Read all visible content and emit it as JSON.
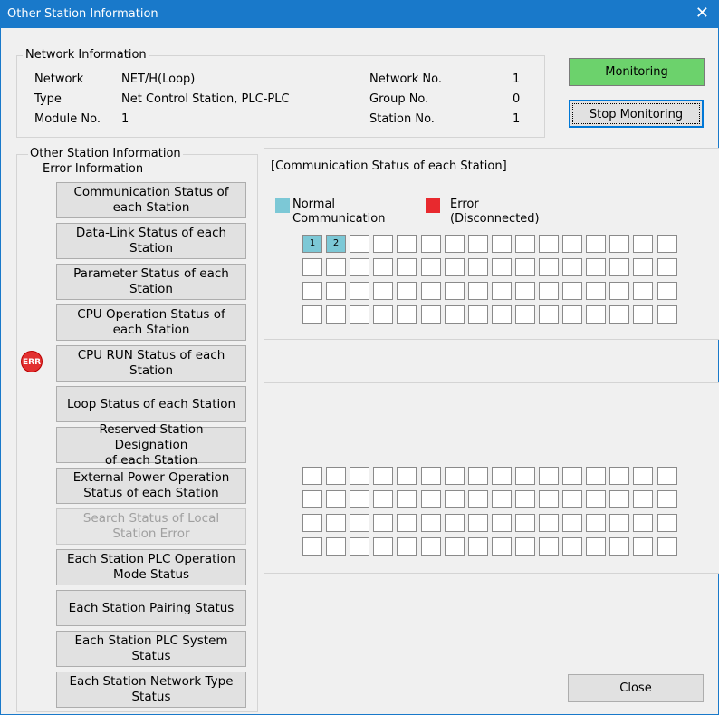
{
  "window": {
    "title": "Other Station Information",
    "close_symbol": "✕"
  },
  "network_info": {
    "legend": "Network Information",
    "rows": [
      {
        "label": "Network",
        "value": "NET/H(Loop)"
      },
      {
        "label": "Type",
        "value": "Net Control Station, PLC-PLC"
      },
      {
        "label": "Module No.",
        "value": "1"
      }
    ],
    "right_rows": [
      {
        "label": "Network No.",
        "value": "1"
      },
      {
        "label": "Group No.",
        "value": "0"
      },
      {
        "label": "Station No.",
        "value": "1"
      }
    ]
  },
  "monitoring": {
    "status": "Monitoring",
    "status_color": "#6cd26c",
    "stop_label": "Stop Monitoring"
  },
  "sidebar": {
    "legend_line1": "Other Station Information",
    "legend_line2": "Error Information",
    "error_badge": "ERR",
    "buttons": [
      {
        "line1": "Communication Status of",
        "line2": "each Station",
        "enabled": true
      },
      {
        "line1": "Data-Link Status of each",
        "line2": "Station",
        "enabled": true
      },
      {
        "line1": "Parameter Status of each",
        "line2": "Station",
        "enabled": true
      },
      {
        "line1": "CPU Operation Status of",
        "line2": "each Station",
        "enabled": true
      },
      {
        "line1": "CPU RUN Status of each",
        "line2": "Station",
        "enabled": true
      },
      {
        "line1": "Loop Status of each Station",
        "line2": "",
        "enabled": true
      },
      {
        "line1": "Reserved Station Designation",
        "line2": "of each Station",
        "enabled": true
      },
      {
        "line1": "External Power Operation",
        "line2": "Status of each Station",
        "enabled": true
      },
      {
        "line1": "Search Status of Local",
        "line2": "Station Error",
        "enabled": false
      },
      {
        "line1": "Each Station PLC Operation",
        "line2": "Mode Status",
        "enabled": true
      },
      {
        "line1": "Each Station Pairing Status",
        "line2": "",
        "enabled": true
      },
      {
        "line1": "Each Station PLC System",
        "line2": "Status",
        "enabled": true
      },
      {
        "line1": "Each Station Network Type",
        "line2": "Status",
        "enabled": true
      }
    ]
  },
  "status_panel": {
    "heading": "[Communication Status of each Station]",
    "legend": [
      {
        "line1": "Normal",
        "line2": "Communication",
        "color": "#7cc8d6"
      },
      {
        "line1": "Error",
        "line2": "(Disconnected)",
        "color": "#e8292e"
      }
    ],
    "grid_labels": [
      "1",
      "2"
    ],
    "normal_count": 2
  },
  "footer": {
    "close_label": "Close"
  }
}
